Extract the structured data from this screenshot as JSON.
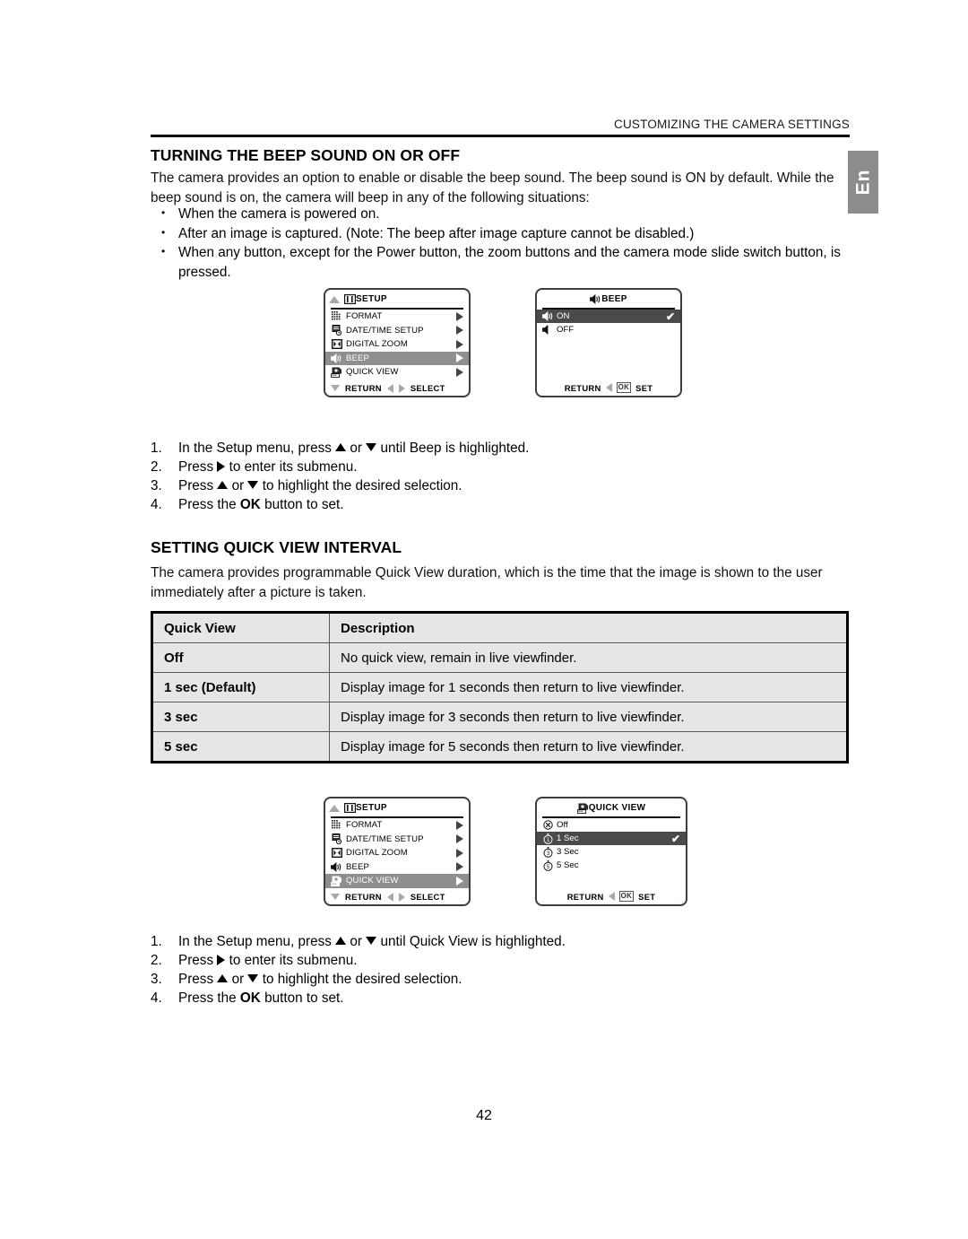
{
  "running_head": "CUSTOMIZING THE CAMERA SETTINGS",
  "side_tab": "En",
  "page_number": "42",
  "section_beep": {
    "heading": "TURNING THE BEEP SOUND ON OR OFF",
    "intro": "The camera provides an option to enable or disable the beep sound. The beep sound is ON by default. While the beep sound is on, the camera will beep in any of the following situations:",
    "bullets": [
      "When the camera is powered on.",
      "After an image is captured. (Note: The beep after image capture cannot be disabled.)",
      "When any button, except for the Power button, the zoom buttons and the camera mode slide switch button, is pressed."
    ],
    "steps": [
      {
        "pre": "In the Setup menu, press ",
        "mid": " or ",
        "post": " until Beep is highlighted."
      },
      {
        "pre": "Press ",
        "post": " to enter its submenu."
      },
      {
        "pre": "Press ",
        "mid": " or ",
        "post": " to highlight the desired selection."
      },
      {
        "pre": "Press the ",
        "bold": "OK",
        "post": " button to set."
      }
    ]
  },
  "section_quickview": {
    "heading": "SETTING QUICK VIEW INTERVAL",
    "intro": "The camera provides programmable Quick View duration, which is the time that the image is shown to the user immediately after a picture is taken.",
    "table": {
      "headers": [
        "Quick View",
        "Description"
      ],
      "rows": [
        [
          "Off",
          "No quick view, remain in live viewfinder."
        ],
        [
          "1 sec (Default)",
          "Display image for 1 seconds then return to live viewfinder."
        ],
        [
          "3 sec",
          "Display image for 3 seconds then return to live viewfinder."
        ],
        [
          "5 sec",
          "Display image for 5 seconds then return to live viewfinder."
        ]
      ]
    },
    "steps": [
      {
        "pre": "In the Setup menu, press ",
        "mid": " or ",
        "post": " until Quick View is highlighted."
      },
      {
        "pre": "Press ",
        "post": " to enter its submenu."
      },
      {
        "pre": "Press ",
        "mid": " or ",
        "post": " to highlight the desired selection."
      },
      {
        "pre": "Press the ",
        "bold": "OK",
        "post": " button to set."
      }
    ]
  },
  "lcd_setup_menu": {
    "title": "SETUP",
    "items": [
      {
        "label": "FORMAT",
        "icon": "format-grid-icon"
      },
      {
        "label": "DATE/TIME SETUP",
        "icon": "date-time-icon"
      },
      {
        "label": "DIGITAL ZOOM",
        "icon": "digital-zoom-icon"
      },
      {
        "label": "BEEP",
        "icon": "speaker-icon"
      },
      {
        "label": "QUICK VIEW",
        "icon": "quick-view-icon"
      }
    ],
    "footer_return": "RETURN",
    "footer_select": "SELECT",
    "highlighted_first": "BEEP",
    "highlighted_second": "QUICK VIEW"
  },
  "lcd_beep_menu": {
    "title": "BEEP",
    "options": [
      {
        "label": "ON",
        "icon": "speaker-on-icon",
        "selected": true,
        "checked": true
      },
      {
        "label": "OFF",
        "icon": "speaker-off-icon",
        "selected": false,
        "checked": false
      }
    ],
    "footer_return": "RETURN",
    "footer_ok": "OK",
    "footer_set": "SET"
  },
  "lcd_quickview_menu": {
    "title": "QUICK VIEW",
    "options": [
      {
        "label": "Off",
        "icon": "circle-x-icon",
        "selected": false,
        "checked": false
      },
      {
        "label": "1 Sec",
        "icon": "timer-1-icon",
        "selected": true,
        "checked": true
      },
      {
        "label": "3 Sec",
        "icon": "timer-3-icon",
        "selected": false,
        "checked": false
      },
      {
        "label": "5 Sec",
        "icon": "timer-5-icon",
        "selected": false,
        "checked": false
      }
    ],
    "footer_return": "RETURN",
    "footer_ok": "OK",
    "footer_set": "SET"
  },
  "glyphs": {
    "check": "✔"
  },
  "colors": {
    "highlight_gray": "#8f8f8f",
    "highlight_dark": "#4a4a4a",
    "table_fill": "#e6e6e6",
    "tab_gray": "#8c8c8c"
  }
}
